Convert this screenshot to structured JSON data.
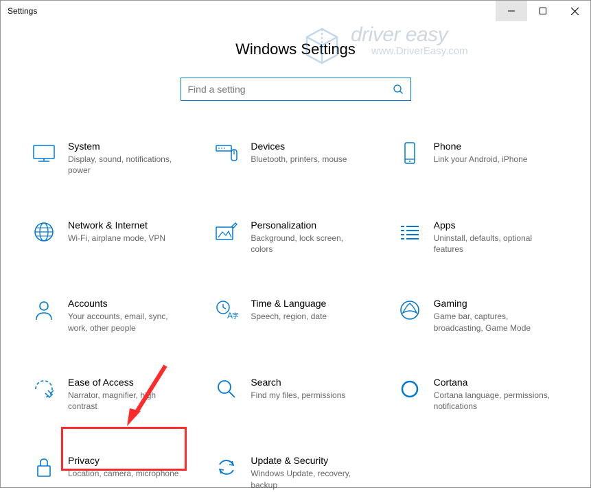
{
  "window": {
    "title": "Settings"
  },
  "page": {
    "heading": "Windows Settings"
  },
  "search": {
    "placeholder": "Find a setting"
  },
  "watermark": {
    "brand": "driver easy",
    "url": "www.DriverEasy.com"
  },
  "tiles": {
    "system": {
      "title": "System",
      "desc": "Display, sound, notifications, power"
    },
    "devices": {
      "title": "Devices",
      "desc": "Bluetooth, printers, mouse"
    },
    "phone": {
      "title": "Phone",
      "desc": "Link your Android, iPhone"
    },
    "network": {
      "title": "Network & Internet",
      "desc": "Wi-Fi, airplane mode, VPN"
    },
    "personalization": {
      "title": "Personalization",
      "desc": "Background, lock screen, colors"
    },
    "apps": {
      "title": "Apps",
      "desc": "Uninstall, defaults, optional features"
    },
    "accounts": {
      "title": "Accounts",
      "desc": "Your accounts, email, sync, work, other people"
    },
    "time": {
      "title": "Time & Language",
      "desc": "Speech, region, date"
    },
    "gaming": {
      "title": "Gaming",
      "desc": "Game bar, captures, broadcasting, Game Mode"
    },
    "ease": {
      "title": "Ease of Access",
      "desc": "Narrator, magnifier, high contrast"
    },
    "searchTile": {
      "title": "Search",
      "desc": "Find my files, permissions"
    },
    "cortana": {
      "title": "Cortana",
      "desc": "Cortana language, permissions, notifications"
    },
    "privacy": {
      "title": "Privacy",
      "desc": "Location, camera, microphone"
    },
    "update": {
      "title": "Update & Security",
      "desc": "Windows Update, recovery, backup"
    }
  }
}
